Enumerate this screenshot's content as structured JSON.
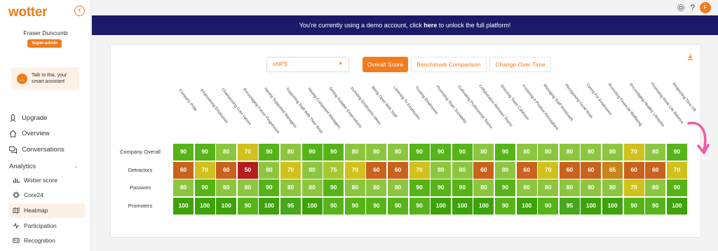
{
  "app": {
    "logo": "wotter"
  },
  "user": {
    "name": "Fraser Duncumb",
    "role": "Super-admin",
    "avatar_initial": "F"
  },
  "assistant": {
    "text": "Talk to Rai, your smart assistant"
  },
  "nav": {
    "upgrade": "Upgrade",
    "overview": "Overview",
    "conversations": "Conversations",
    "analytics": "Analytics",
    "sub": [
      "Wotter score",
      "Core24",
      "Heatmap",
      "Participation",
      "Recognition"
    ]
  },
  "topbar": {
    "help": "?"
  },
  "banner": {
    "before": "You're currently using a demo account, click ",
    "link": "here",
    "after": " to unlock the full platform!"
  },
  "filters": {
    "metric": "eNPS",
    "tabs": [
      "Overall Score",
      "Benchmark Comparison",
      "Change Over Time"
    ]
  },
  "colors": {
    "accent": "#f07c1c",
    "banner": "#1a1a68"
  },
  "heatmap": {
    "columns": [
      "Company Pride",
      "Empowering Employees",
      "Championing Core Values",
      "Encouraging Future Progression",
      "Having Supported Managers",
      "Supporting Staff With Their Work",
      "Having Competent Managers",
      "Setting Suitable Expectations",
      "Including Employees Ideas",
      "Being Open With Staff",
      "Listening To Employees",
      "Trusting Employees",
      "Promoting Team Sociability",
      "Cultivating Professional Teams",
      "Collaboration Between Teams",
      "Ensuring Team Cohesion",
      "Fostering A Positive Atmosphere",
      "Managing Staff Workloads",
      "Recognising Good Work",
      "Caring For Employees",
      "Promoting Financial Wellbeing",
      "Encouraging Healthy Lifestyles",
      "Promoting Work-Life Balance",
      "Respecting Time Off"
    ],
    "rows": [
      {
        "label": "Company Overall",
        "values": [
          90,
          90,
          80,
          70,
          90,
          80,
          90,
          90,
          80,
          80,
          80,
          90,
          90,
          90,
          80,
          90,
          80,
          80,
          80,
          80,
          80,
          70,
          80,
          90
        ]
      },
      {
        "label": "Detractors",
        "values": [
          60,
          70,
          60,
          50,
          80,
          70,
          80,
          75,
          70,
          60,
          60,
          70,
          80,
          80,
          60,
          80,
          60,
          70,
          60,
          60,
          65,
          60,
          60,
          70
        ]
      },
      {
        "label": "Passives",
        "values": [
          80,
          90,
          80,
          80,
          90,
          80,
          80,
          90,
          80,
          80,
          80,
          90,
          90,
          90,
          80,
          90,
          80,
          80,
          80,
          80,
          80,
          70,
          80,
          90
        ]
      },
      {
        "label": "Promoters",
        "values": [
          100,
          100,
          100,
          90,
          100,
          95,
          100,
          90,
          90,
          90,
          90,
          90,
          100,
          100,
          100,
          90,
          100,
          90,
          95,
          100,
          100,
          90,
          90,
          100
        ]
      }
    ]
  }
}
